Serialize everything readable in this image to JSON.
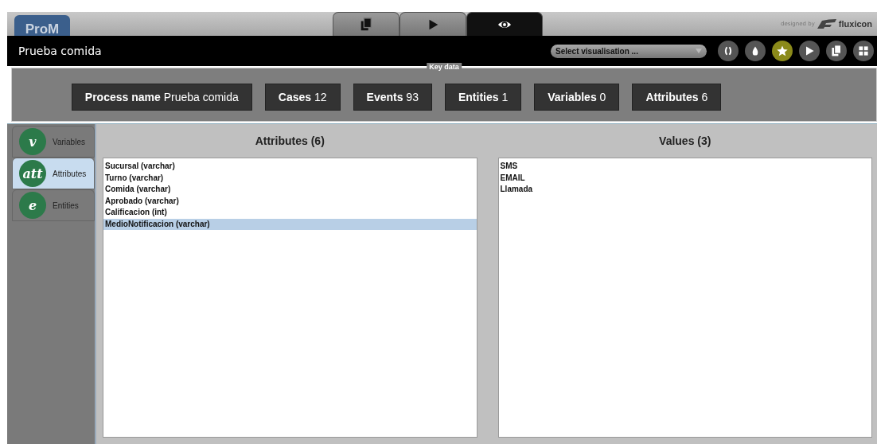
{
  "header": {
    "logo": "ProM",
    "credit": "designed by",
    "brand": "fluxicon"
  },
  "top_tabs": [
    {
      "kind": "docs",
      "selected": false
    },
    {
      "kind": "play",
      "selected": false
    },
    {
      "kind": "eye",
      "selected": true
    }
  ],
  "title_bar": {
    "title": "Prueba comida",
    "select": {
      "placeholder": "Select visualisation ..."
    }
  },
  "tool_buttons": [
    {
      "kind": "brackets",
      "selected": false
    },
    {
      "kind": "drop",
      "selected": false
    },
    {
      "kind": "star",
      "selected": true
    },
    {
      "kind": "play",
      "selected": false
    },
    {
      "kind": "docs",
      "selected": false
    },
    {
      "kind": "grid",
      "selected": false
    }
  ],
  "key_data": {
    "legend": "Key data",
    "items": [
      {
        "label": "Process name",
        "value": "Prueba comida"
      },
      {
        "label": "Cases",
        "value": "12"
      },
      {
        "label": "Events",
        "value": "93"
      },
      {
        "label": "Entities",
        "value": "1"
      },
      {
        "label": "Variables",
        "value": "0"
      },
      {
        "label": "Attributes",
        "value": "6"
      }
    ]
  },
  "side_tabs": [
    {
      "glyph": "v",
      "label": "Variables",
      "selected": false
    },
    {
      "glyph": "att",
      "label": "Attributes",
      "selected": true
    },
    {
      "glyph": "e",
      "label": "Entities",
      "selected": false
    }
  ],
  "attributes": {
    "heading": "Attributes (6)",
    "items": [
      {
        "text": "Sucursal (varchar)",
        "selected": false
      },
      {
        "text": "Turno (varchar)",
        "selected": false
      },
      {
        "text": "Comida (varchar)",
        "selected": false
      },
      {
        "text": "Aprobado (varchar)",
        "selected": false
      },
      {
        "text": "Calificacion (int)",
        "selected": false
      },
      {
        "text": "MedioNotificacion (varchar)",
        "selected": true
      }
    ]
  },
  "values": {
    "heading": "Values (3)",
    "items": [
      {
        "text": "SMS",
        "selected": false
      },
      {
        "text": "EMAIL",
        "selected": false
      },
      {
        "text": "Llamada",
        "selected": false
      }
    ]
  }
}
